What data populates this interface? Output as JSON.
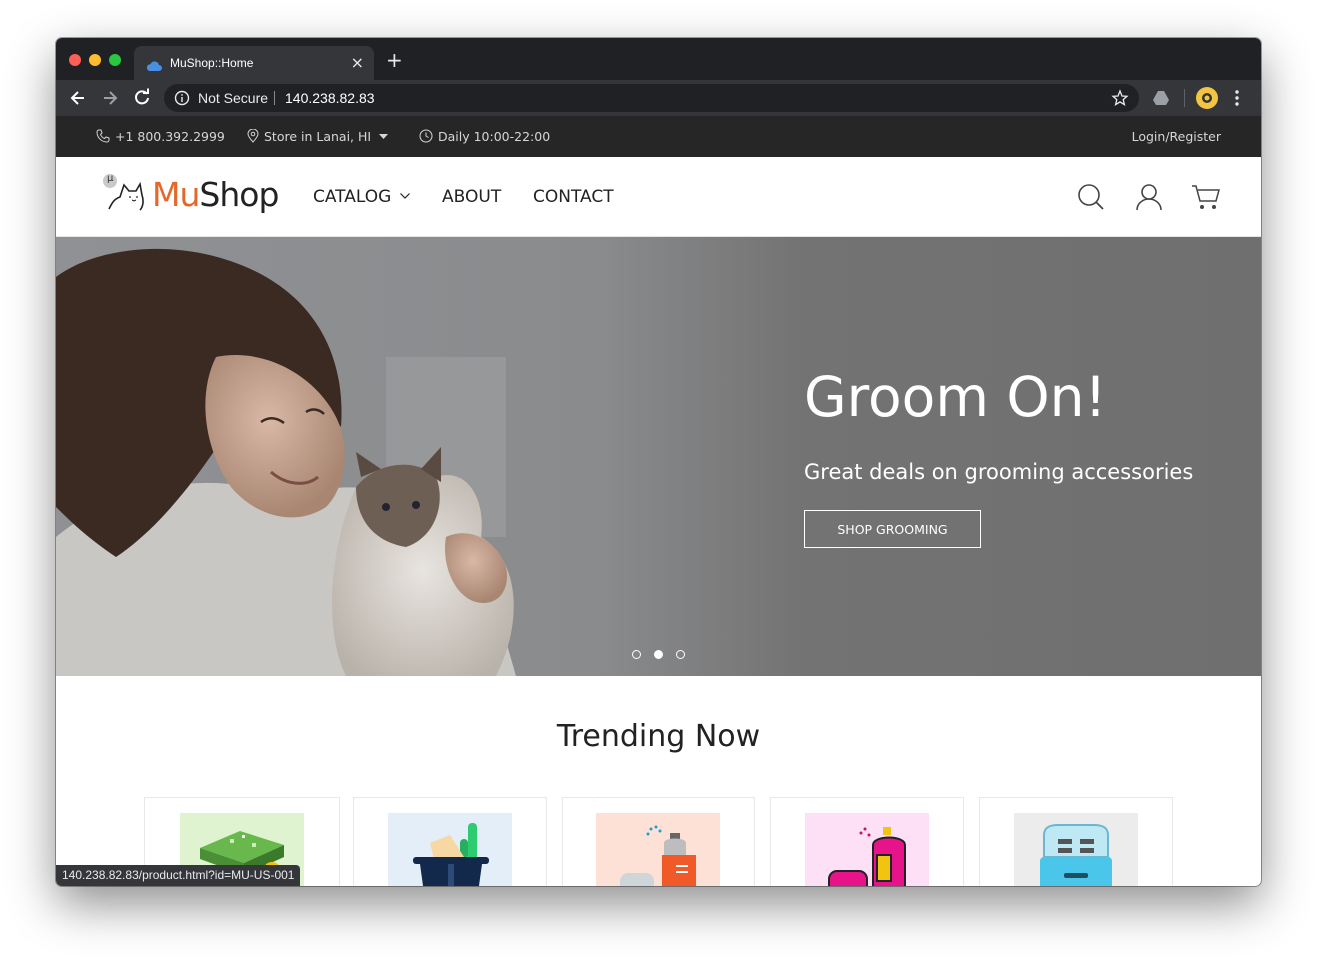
{
  "browser": {
    "tab_title": "MuShop::Home",
    "tab_close": "×",
    "new_tab": "+",
    "security_label": "Not Secure",
    "url": "140.238.82.83",
    "status_url": "140.238.82.83/product.html?id=MU-US-001"
  },
  "topbar": {
    "phone": "+1 800.392.2999",
    "store": "Store in Lanai, HI",
    "hours": "Daily 10:00-22:00",
    "login": "Login/Register"
  },
  "header": {
    "logo_mu": "Mu",
    "logo_shop": "Shop",
    "logo_badge": "μ",
    "nav": [
      "CATALOG",
      "ABOUT",
      "CONTACT"
    ]
  },
  "hero": {
    "title": "Groom On!",
    "subtitle": "Great deals on grooming accessories",
    "button": "SHOP GROOMING",
    "slides": 3,
    "active_slide": 2
  },
  "trending": {
    "title": "Trending Now",
    "products": [
      {
        "icon": "cat-bed-icon",
        "bg": "#dff3d0"
      },
      {
        "icon": "pet-basket-icon",
        "bg": "#e3eef8"
      },
      {
        "icon": "spray-bottle-icon",
        "bg": "#fde0d6"
      },
      {
        "icon": "shampoo-spray-icon",
        "bg": "#fde0f5"
      },
      {
        "icon": "pet-carrier-icon",
        "bg": "#ececec"
      }
    ]
  },
  "colors": {
    "accent": "#e2692a",
    "topbar": "#272626",
    "hero_bg": "#6f6f6f"
  }
}
